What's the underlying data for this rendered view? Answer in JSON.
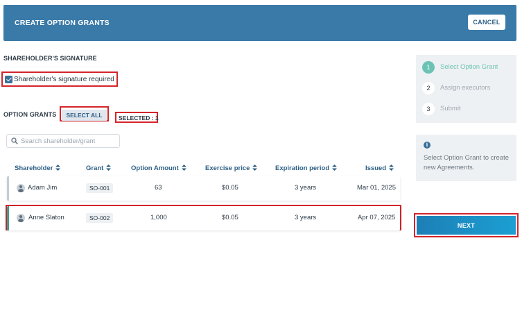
{
  "header": {
    "title": "CREATE OPTION GRANTS",
    "cancel_label": "CANCEL"
  },
  "signature": {
    "section_title": "SHAREHOLDER'S SIGNATURE",
    "checkbox_label": "Shareholder's signature required",
    "checked": true
  },
  "grants": {
    "section_title": "OPTION GRANTS",
    "select_all_label": "SELECT ALL",
    "selected_text": "SELECTED : 1",
    "search_placeholder": "Search shareholder/grant"
  },
  "table": {
    "columns": [
      "Shareholder",
      "Grant",
      "Option Amount",
      "Exercise price",
      "Expiration period",
      "Issued"
    ],
    "rows": [
      {
        "shareholder": "Adam Jim",
        "grant": "SO-001",
        "amount": "63",
        "price": "$0.05",
        "expiration": "3 years",
        "issued": "Mar 01, 2025"
      },
      {
        "shareholder": "Anne Slaton",
        "grant": "SO-002",
        "amount": "1,000",
        "price": "$0.05",
        "expiration": "3 years",
        "issued": "Apr 07, 2025"
      }
    ]
  },
  "stepper": {
    "steps": [
      {
        "number": "1",
        "label": "Select Option Grant"
      },
      {
        "number": "2",
        "label": "Assign executors"
      },
      {
        "number": "3",
        "label": "Submit"
      }
    ]
  },
  "info": {
    "text": "Select Option Grant to create new Agreements."
  },
  "next_label": "NEXT",
  "colors": {
    "header_bg": "#3a7aa8",
    "accent_green": "#6cc3b5",
    "highlight_red": "#d4242b",
    "next_button": "#1b9fd2"
  }
}
